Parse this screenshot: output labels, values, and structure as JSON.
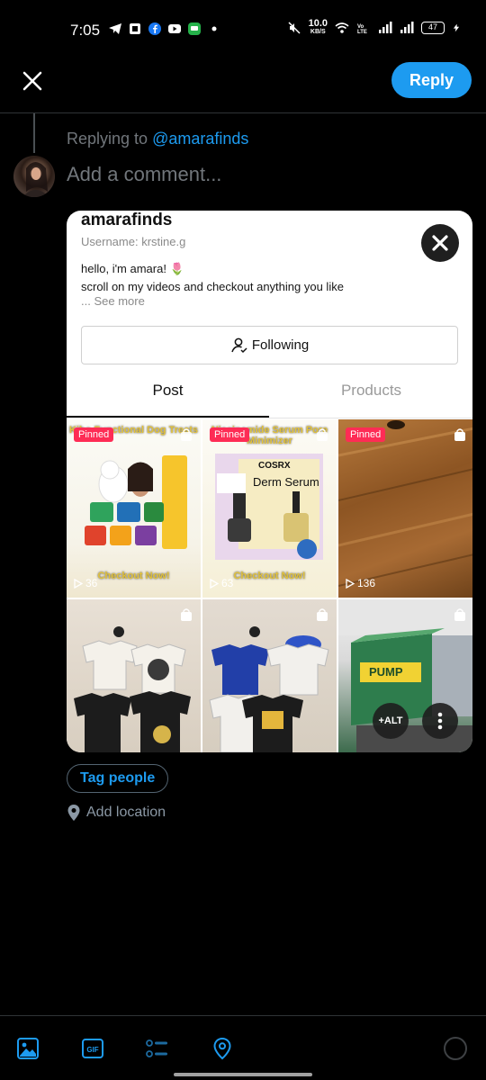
{
  "status_bar": {
    "time": "7:05",
    "net_speed_top": "10.0",
    "net_speed_bottom": "KB/S",
    "battery": "47"
  },
  "header": {
    "reply_label": "Reply"
  },
  "reply_context": {
    "prefix": "Replying to ",
    "handle": "@amarafinds"
  },
  "composer": {
    "placeholder": "Add a comment..."
  },
  "card": {
    "name": "amarafinds",
    "username": "Username: krstine.g",
    "bio_line1": "hello, i'm amara! 🌷",
    "bio_line2": "scroll on my videos and checkout anything you like",
    "see_more": "... See more",
    "follow_label": "Following",
    "tabs": [
      "Post",
      "Products"
    ],
    "tiles": [
      {
        "pinned": "Pinned",
        "title": "Kibo Functional Dog Treats",
        "footer": "Checkout Now!",
        "views": "36"
      },
      {
        "pinned": "Pinned",
        "title": "Niacinamide Serum Pore Minimizer",
        "footer": "Checkout Now!",
        "views": "63",
        "brand": "COSRX",
        "product": "Derm Serum"
      },
      {
        "pinned": "Pinned",
        "views": "136"
      },
      {},
      {},
      {
        "product": "PUMP"
      }
    ]
  },
  "media_actions": {
    "alt_label": "+ALT"
  },
  "tag_people": "Tag people",
  "add_location": "Add location",
  "colors": {
    "accent": "#1d9bf0",
    "background": "#000000",
    "pinned": "#fe2c55"
  }
}
